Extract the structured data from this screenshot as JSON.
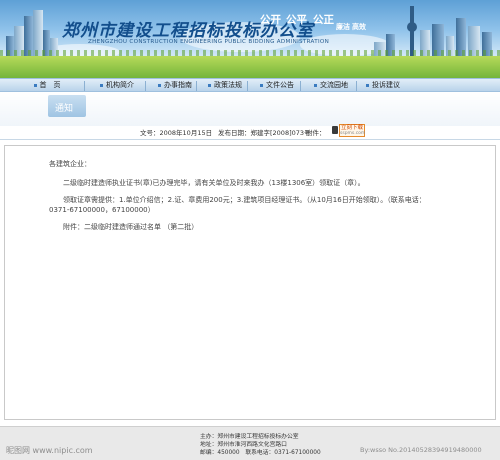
{
  "header": {
    "site_title": "郑州市建设工程招标投标办公室",
    "site_subtitle": "ZHENGZHOU CONSTRUCTION ENGINEERING PUBLIC BIDDING ADMINISTRATION",
    "slogans": [
      "公开",
      "公平",
      "公正",
      "廉洁",
      "高效"
    ]
  },
  "nav": {
    "items": [
      "首　页",
      "机构简介",
      "办事指南",
      "政策法规",
      "文件公告",
      "交流园地",
      "投诉建议"
    ]
  },
  "section": {
    "title": "通知"
  },
  "meta": {
    "doc_no": "文号：2008年10月15日",
    "publish_date": "发布日期：郑建字[2008]073号",
    "attachment_label": "附件：",
    "download_label": "立刻下载",
    "download_url": "sspms.com"
  },
  "notice": {
    "greeting": "各建筑企业：",
    "para1": "二级临时建造师执业证书(章)已办理完毕，请有关单位及时来我办（13楼1306室）领取证（章）。",
    "para2_line1": "领取证章需提供：1.单位介绍信；2.证、章费用200元；3.建筑项目经理证书。（从10月16日开始领取）。（联系电话：",
    "para2_line2": "0371-67100000，67100000）",
    "attachment": "附件：二级临时建造师通过名单 （第二批）"
  },
  "footer": {
    "address_title": "主办：郑州市建设工程招标投标办公室",
    "address": "地址：郑州市淮河西路文化宫路口",
    "zip_phone": "邮编：450000　联系电话：0371-67100000"
  },
  "watermark": {
    "left": "昵图网 www.nipic.com",
    "right": "By:wsso  No.20140528394919480000"
  }
}
